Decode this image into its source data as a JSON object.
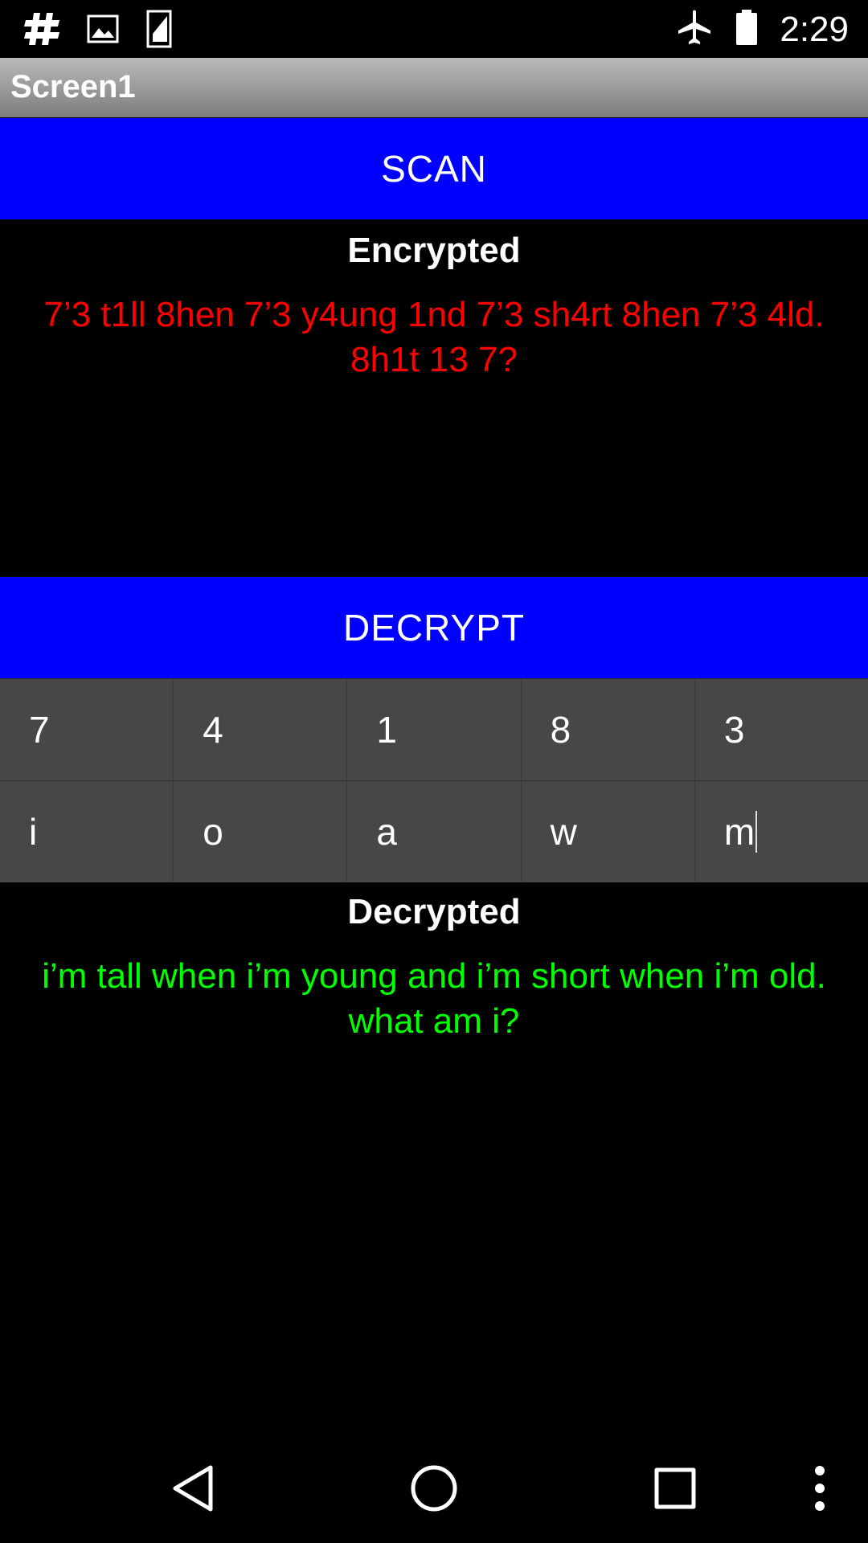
{
  "status_bar": {
    "time": "2:29",
    "icons": [
      "hash-icon",
      "image-icon",
      "sd-card-icon",
      "airplane-mode-icon",
      "battery-icon"
    ]
  },
  "title_bar": {
    "title": "Screen1"
  },
  "scan_button": {
    "label": "SCAN"
  },
  "encrypted": {
    "label": "Encrypted",
    "text": "7’3 t1ll 8hen 7’3 y4ung 1nd 7’3 sh4rt 8hen 7’3 4ld. 8h1t 13 7?",
    "color": "#ff0000"
  },
  "decrypt_button": {
    "label": "DECRYPT"
  },
  "key_grid": {
    "cipher_row": [
      "7",
      "4",
      "1",
      "8",
      "3"
    ],
    "plain_row": [
      "i",
      "o",
      "a",
      "w",
      "m"
    ]
  },
  "decrypted": {
    "label": "Decrypted",
    "text": "i’m tall when i’m young and i’m short when i’m old. what am i?",
    "color": "#00ff00"
  },
  "colors": {
    "button_blue": "#0000ff",
    "cell_gray": "#474747"
  },
  "nav_bar": {
    "icons": [
      "back-icon",
      "home-icon",
      "recents-icon",
      "overflow-menu-icon"
    ]
  }
}
